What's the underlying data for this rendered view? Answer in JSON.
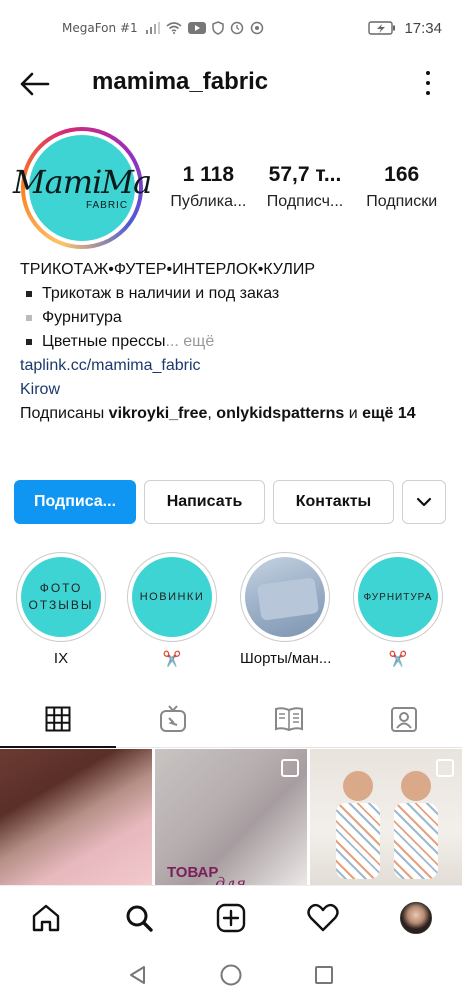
{
  "status_bar": {
    "carrier": "MegaFon #1",
    "time": "17:34",
    "icons": [
      "signal-icon",
      "wifi-icon",
      "youtube-icon",
      "shield-icon",
      "clock-icon",
      "timer-icon",
      "battery-charging-icon"
    ]
  },
  "header": {
    "username": "mamima_fabric"
  },
  "profile": {
    "avatar_logo": "MamiMa",
    "avatar_logo_sub": "FABRIC",
    "stats": [
      {
        "value": "1 118",
        "label": "Публика..."
      },
      {
        "value": "57,7 т...",
        "label": "Подписч..."
      },
      {
        "value": "166",
        "label": "Подписки"
      }
    ],
    "bio": {
      "title": "ТРИКОТАЖ•ФУТЕР•ИНТЕРЛОК•КУЛИР",
      "lines": [
        "Трикотаж в наличии и под заказ",
        "Фурнитура",
        "Цветные прессы"
      ],
      "more": "... ещё",
      "link": "taplink.cc/mamima_fabric",
      "location": "Kirow",
      "followed_prefix": "Подписаны ",
      "followed_user1": "vikroyki_free",
      "followed_sep": ", ",
      "followed_user2": "onlykidspatterns",
      "followed_and": " и ",
      "followed_more": "ещё 14"
    }
  },
  "actions": {
    "follow": "Подписа...",
    "message": "Написать",
    "contacts": "Контакты"
  },
  "highlights": [
    {
      "cover_text": "ФОТО ОТЗЫВЫ",
      "label": "IX"
    },
    {
      "cover_text": "НОВИНКИ",
      "label": "✂️"
    },
    {
      "cover_text": "",
      "label": "Шорты/ман..."
    },
    {
      "cover_text": "ФУРНИТУРА",
      "label": "✂️"
    }
  ],
  "grid": {
    "post2_text1": "ТОВАР",
    "post2_text2": "для"
  }
}
